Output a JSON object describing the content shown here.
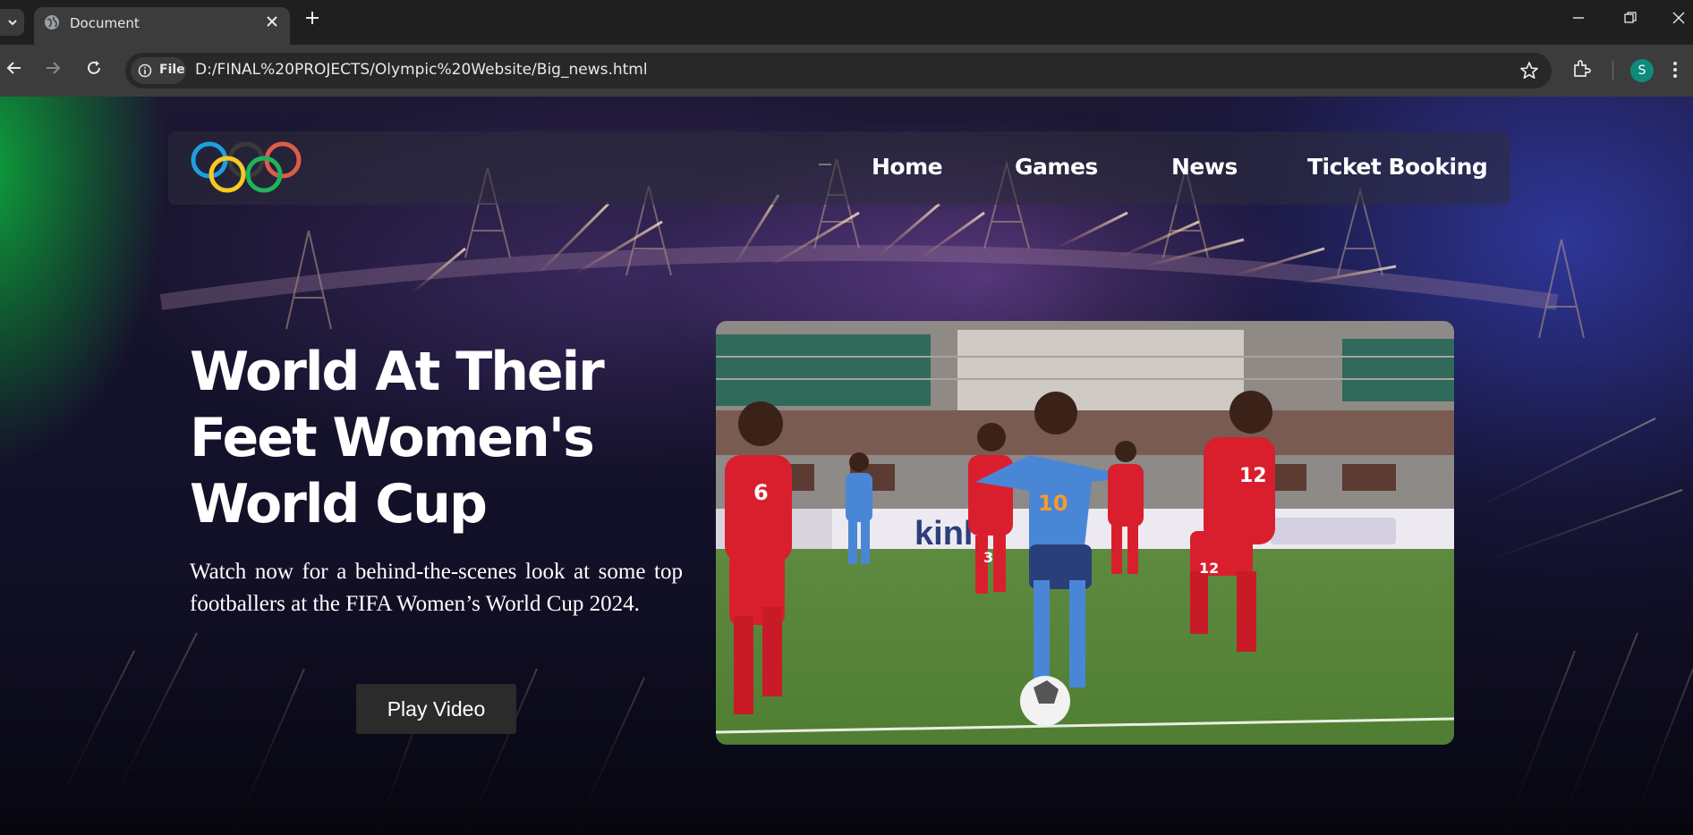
{
  "browser": {
    "tab_title": "Document",
    "chip_label": "File",
    "url": "D:/FINAL%20PROJECTS/Olympic%20Website/Big_news.html",
    "profile_initial": "S",
    "profile_color": "#0f8a7d"
  },
  "nav": {
    "links": [
      "Home",
      "Games",
      "News",
      "Ticket Booking"
    ]
  },
  "hero": {
    "headline_lines": [
      "World At Their",
      "Feet Women's",
      "World Cup"
    ],
    "description": "Watch now for a behind-the-scenes look at some top footballers at the FIFA Women’s World Cup 2024.",
    "button_label": "Play Video"
  },
  "photo": {
    "jersey_numbers": [
      "6",
      "3",
      "10",
      "12",
      "6",
      "12"
    ],
    "banner_text": "kinl",
    "player_colors": {
      "red_team": "#d91f2e",
      "blue_team": "#4a86d6"
    }
  },
  "colors": {
    "ring_blue": "#1e9fe0",
    "ring_yellow": "#f6c924",
    "ring_black": "#3a3a3a",
    "ring_green": "#1fb35c",
    "ring_red": "#e05a4a"
  }
}
